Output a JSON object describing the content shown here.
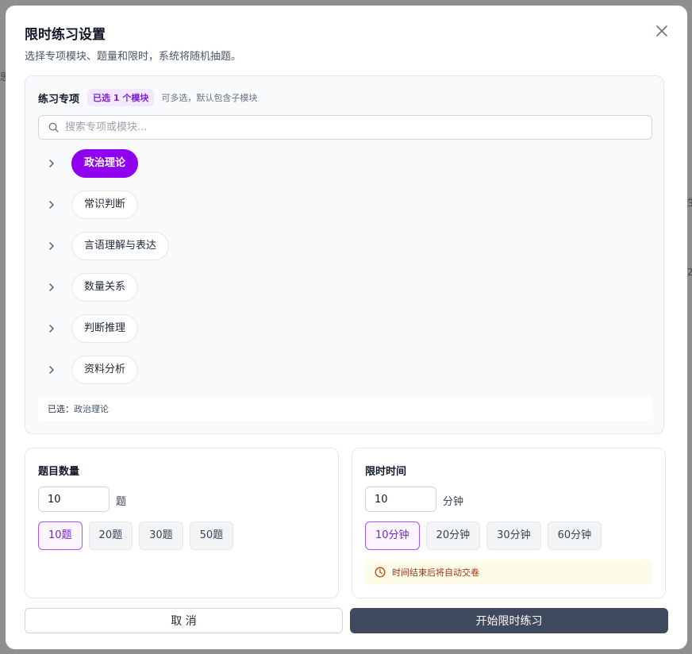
{
  "dialog": {
    "title": "限时练习设置",
    "subtitle": "选择专项模块、题量和限时，系统将随机抽题。"
  },
  "modules": {
    "title": "练习专项",
    "count_badge": "已选 1 个模块",
    "hint": "可多选，默认包含子模块",
    "search_placeholder": "搜索专项或模块...",
    "items": [
      {
        "label": "政治理论",
        "selected": true
      },
      {
        "label": "常识判断",
        "selected": false
      },
      {
        "label": "言语理解与表达",
        "selected": false
      },
      {
        "label": "数量关系",
        "selected": false
      },
      {
        "label": "判断推理",
        "selected": false
      },
      {
        "label": "资料分析",
        "selected": false
      }
    ],
    "selected_prefix": "已选：",
    "selected_value": "政治理论"
  },
  "question_count": {
    "title": "题目数量",
    "value": "10",
    "unit": "题",
    "presets": [
      "10题",
      "20题",
      "30题",
      "50题"
    ],
    "active_index": 0
  },
  "time_limit": {
    "title": "限时时间",
    "value": "10",
    "unit": "分钟",
    "presets": [
      "10分钟",
      "20分钟",
      "30分钟",
      "60分钟"
    ],
    "active_index": 0,
    "notice": "时间结束后将自动交卷"
  },
  "actions": {
    "cancel": "取 消",
    "start": "开始限时练习"
  },
  "colors": {
    "accent": "#8f00ee",
    "primary_button": "#3f4a5e",
    "badge_bg": "#f3e8ff",
    "notice_bg": "#fefce8"
  },
  "icons": {
    "close": "close-icon",
    "search": "search-icon",
    "expand": "chevron-right-icon",
    "clock": "clock-icon"
  }
}
